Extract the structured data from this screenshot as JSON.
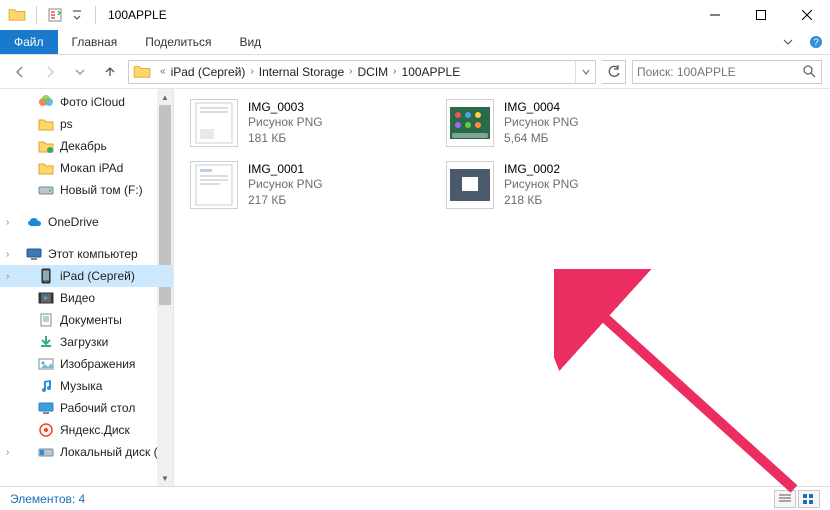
{
  "window": {
    "title": "100APPLE"
  },
  "ribbon": {
    "file_label": "Файл",
    "tabs": [
      "Главная",
      "Поделиться",
      "Вид"
    ]
  },
  "breadcrumbs": {
    "items": [
      "iPad (Сергей)",
      "Internal Storage",
      "DCIM",
      "100APPLE"
    ]
  },
  "search": {
    "placeholder": "Поиск: 100APPLE"
  },
  "sidebar": {
    "items": [
      {
        "label": "Фото iCloud",
        "icon": "photos",
        "level": 2
      },
      {
        "label": "ps",
        "icon": "folder",
        "level": 2
      },
      {
        "label": "Декабрь",
        "icon": "folder-pinned",
        "level": 2
      },
      {
        "label": "Мокап iPAd",
        "icon": "folder",
        "level": 2
      },
      {
        "label": "Новый том (F:)",
        "icon": "drive",
        "level": 2
      },
      {
        "label": "OneDrive",
        "icon": "onedrive",
        "level": 1,
        "caret": true,
        "spaced_before": true
      },
      {
        "label": "Этот компьютер",
        "icon": "pc",
        "level": 1,
        "caret": true,
        "spaced_before": true
      },
      {
        "label": "iPad (Сергей)",
        "icon": "ipad",
        "level": 2,
        "selected": true,
        "caret": true
      },
      {
        "label": "Видео",
        "icon": "video",
        "level": 2
      },
      {
        "label": "Документы",
        "icon": "docs",
        "level": 2
      },
      {
        "label": "Загрузки",
        "icon": "downloads",
        "level": 2
      },
      {
        "label": "Изображения",
        "icon": "images",
        "level": 2
      },
      {
        "label": "Музыка",
        "icon": "music",
        "level": 2
      },
      {
        "label": "Рабочий стол",
        "icon": "desktop",
        "level": 2
      },
      {
        "label": "Яндекс.Диск",
        "icon": "yadisk",
        "level": 2
      },
      {
        "label": "Локальный диск (",
        "icon": "drive-c",
        "level": 2,
        "caret": true
      }
    ]
  },
  "files": [
    {
      "name": "IMG_0001",
      "type": "Рисунок PNG",
      "size": "217 КБ",
      "thumb": "white-doc"
    },
    {
      "name": "IMG_0002",
      "type": "Рисунок PNG",
      "size": "218 КБ",
      "thumb": "dark-screenshot"
    },
    {
      "name": "IMG_0003",
      "type": "Рисунок PNG",
      "size": "181 КБ",
      "thumb": "white-doc2"
    },
    {
      "name": "IMG_0004",
      "type": "Рисунок PNG",
      "size": "5,64 МБ",
      "thumb": "ipad-home"
    }
  ],
  "statusbar": {
    "label": "Элементов: 4"
  }
}
